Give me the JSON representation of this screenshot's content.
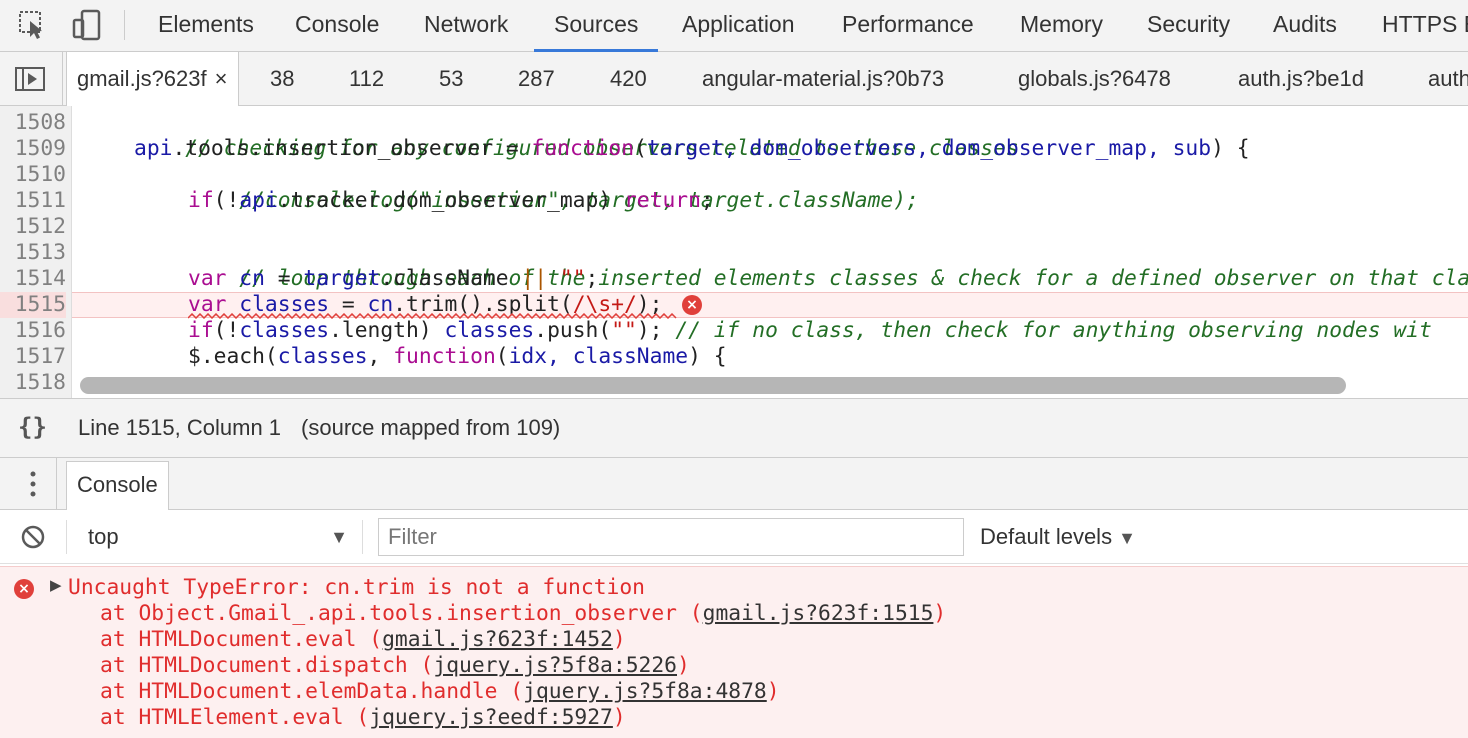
{
  "toolbar": {
    "tabs": [
      {
        "label": "Elements"
      },
      {
        "label": "Console"
      },
      {
        "label": "Network"
      },
      {
        "label": "Sources"
      },
      {
        "label": "Application"
      },
      {
        "label": "Performance"
      },
      {
        "label": "Memory"
      },
      {
        "label": "Security"
      },
      {
        "label": "Audits"
      },
      {
        "label": "HTTPS E"
      }
    ],
    "active_tab": "Sources",
    "icons": [
      "inspect-element-icon",
      "device-toolbar-icon"
    ]
  },
  "file_tabs": {
    "active": {
      "label": "gmail.js?623f",
      "close": "×"
    },
    "others": [
      "38",
      "112",
      "53",
      "287",
      "420",
      "angular-material.js?0b73",
      "globals.js?6478",
      "auth.js?be1d",
      "auth"
    ]
  },
  "editor": {
    "line_numbers": [
      "1508",
      "1509",
      "1510",
      "1511",
      "1512",
      "1513",
      "1514",
      "1515",
      "1516",
      "1517",
      "1518"
    ],
    "error_line": "1515",
    "lines": {
      "l1508": "// checking for any configured observers related to those classes",
      "l1509_a": "api",
      "l1509_b": ".tools.insertion_observer = ",
      "l1509_c": "function",
      "l1509_d": "(",
      "l1509_e": "target, dom_observers, dom_observer_map, sub",
      "l1509_f": ") {",
      "l1510": "//console.log(\"insertion\", target, target.className);",
      "l1511_a": "if",
      "l1511_b": "(!",
      "l1511_c": "api",
      "l1511_d": ".tracker.dom_observer_map) ",
      "l1511_e": "return",
      "l1511_f": ";",
      "l1513": "// loop through each of the inserted elements classes & check for a defined observer on that clas",
      "l1514_a": "var",
      "l1514_b": " cn",
      "l1514_c": " = ",
      "l1514_d": "target",
      "l1514_e": ".className ",
      "l1514_f": "||",
      "l1514_g": " ",
      "l1514_h": "\"\"",
      "l1514_i": ";",
      "l1515_a": "var",
      "l1515_b": " classes",
      "l1515_c": " = ",
      "l1515_d": "cn",
      "l1515_e": ".trim().split(",
      "l1515_f": "/\\s+/",
      "l1515_g": ");",
      "l1516_a": "if",
      "l1516_b": "(!",
      "l1516_c": "classes",
      "l1516_d": ".length) ",
      "l1516_e": "classes",
      "l1516_f": ".push(",
      "l1516_g": "\"\"",
      "l1516_h": "); ",
      "l1516_i": "// if no class, then check for anything observing nodes wit",
      "l1517_a": "$.each(",
      "l1517_b": "classes",
      "l1517_c": ", ",
      "l1517_d": "function",
      "l1517_e": "(",
      "l1517_f": "idx, className",
      "l1517_g": ") {"
    },
    "error_icon": "×"
  },
  "status_bar": {
    "pretty_print": "{}",
    "position": "Line 1515, Column 1",
    "source_mapped": "(source mapped from 109)"
  },
  "drawer": {
    "tab": "Console",
    "menu_icon": "more-vertical-icon"
  },
  "console_toolbar": {
    "context": "top",
    "arrow": "▼",
    "filter_placeholder": "Filter",
    "levels": "Default levels",
    "levels_arrow": "▼"
  },
  "console": {
    "error": {
      "icon": "×",
      "expander": "▶",
      "message": "Uncaught TypeError: cn.trim is not a function",
      "stack": [
        {
          "prefix": "at Object.Gmail_.api.tools.insertion_observer (",
          "link": "gmail.js?623f:1515",
          "suffix": ")"
        },
        {
          "prefix": "at HTMLDocument.eval (",
          "link": "gmail.js?623f:1452",
          "suffix": ")"
        },
        {
          "prefix": "at HTMLDocument.dispatch (",
          "link": "jquery.js?5f8a:5226",
          "suffix": ")"
        },
        {
          "prefix": "at HTMLDocument.elemData.handle (",
          "link": "jquery.js?5f8a:4878",
          "suffix": ")"
        },
        {
          "prefix": "at HTMLElement.eval (",
          "link": "jquery.js?eedf:5927",
          "suffix": ")"
        }
      ]
    }
  },
  "colors": {
    "active_tab_underline": "#3879d9",
    "error_red": "#e02d2d",
    "error_bg": "#fdf0f0",
    "keyword": "#aa0d91",
    "comment": "#236e25"
  }
}
